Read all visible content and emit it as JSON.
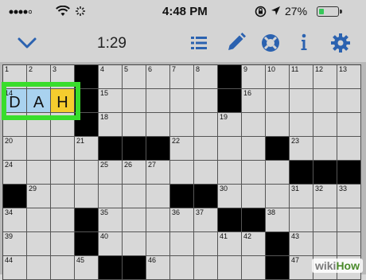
{
  "status_bar": {
    "time": "4:48 PM",
    "battery_percent": "27%",
    "battery_level": 0.27,
    "colors": {
      "battery_fill": "#35c759"
    }
  },
  "toolbar": {
    "timer": "1:29",
    "icons": [
      "chevron-down-icon",
      "list-icon",
      "pencil-icon",
      "lifebuoy-icon",
      "info-icon",
      "gear-icon"
    ],
    "accent": "#2b62b0"
  },
  "grid": {
    "rows": [
      [
        {
          "n": "1"
        },
        {
          "n": "2"
        },
        {
          "n": "3"
        },
        {
          "b": true
        },
        {
          "n": "4"
        },
        {
          "n": "5"
        },
        {
          "n": "6"
        },
        {
          "n": "7"
        },
        {
          "n": "8"
        },
        {
          "b": true
        },
        {
          "n": "9"
        },
        {
          "n": "10"
        },
        {
          "n": "11"
        },
        {
          "n": "12"
        },
        {
          "n": "13"
        }
      ],
      [
        {
          "n": "14",
          "l": "D",
          "s": "word"
        },
        {
          "l": "A",
          "s": "word"
        },
        {
          "l": "H",
          "s": "current"
        },
        {
          "b": true
        },
        {
          "n": "15"
        },
        {},
        {},
        {},
        {},
        {
          "b": true
        },
        {
          "n": "16"
        },
        {},
        {},
        {},
        {}
      ],
      [
        {},
        {},
        {},
        {
          "b": true
        },
        {
          "n": "18"
        },
        {},
        {},
        {},
        {},
        {
          "n": "19"
        },
        {},
        {},
        {},
        {},
        {}
      ],
      [
        {
          "n": "20"
        },
        {},
        {},
        {
          "n": "21"
        },
        {
          "b": true
        },
        {
          "b": true
        },
        {
          "b": true
        },
        {
          "n": "22"
        },
        {},
        {},
        {},
        {
          "b": true
        },
        {
          "n": "23"
        },
        {},
        {}
      ],
      [
        {
          "n": "24"
        },
        {},
        {},
        {},
        {
          "n": "25"
        },
        {
          "n": "26"
        },
        {
          "n": "27"
        },
        {},
        {},
        {},
        {},
        {},
        {
          "b": true
        },
        {
          "b": true
        },
        {
          "b": true
        }
      ],
      [
        {
          "b": true
        },
        {
          "n": "29"
        },
        {},
        {},
        {},
        {},
        {},
        {
          "b": true
        },
        {
          "b": true
        },
        {
          "n": "30"
        },
        {},
        {},
        {
          "n": "31"
        },
        {
          "n": "32"
        },
        {
          "n": "33"
        }
      ],
      [
        {
          "n": "34"
        },
        {},
        {},
        {
          "b": true
        },
        {
          "n": "35"
        },
        {},
        {},
        {
          "n": "36"
        },
        {
          "n": "37"
        },
        {
          "b": true
        },
        {
          "b": true
        },
        {
          "n": "38"
        },
        {},
        {},
        {}
      ],
      [
        {
          "n": "39"
        },
        {},
        {},
        {
          "b": true
        },
        {
          "n": "40"
        },
        {},
        {},
        {},
        {},
        {
          "n": "41"
        },
        {
          "n": "42"
        },
        {
          "b": true
        },
        {
          "n": "43"
        },
        {},
        {}
      ],
      [
        {
          "n": "44"
        },
        {},
        {},
        {
          "n": "45"
        },
        {
          "b": true
        },
        {
          "b": true
        },
        {
          "n": "46"
        },
        {},
        {},
        {},
        {},
        {
          "b": true
        },
        {
          "n": "47"
        },
        {},
        {}
      ]
    ],
    "colors": {
      "word": "#a9d2ef",
      "current": "#f5cd2e",
      "highlight_border": "#39dd2c"
    }
  },
  "watermark": {
    "part1": "wiki",
    "part2": "How"
  }
}
